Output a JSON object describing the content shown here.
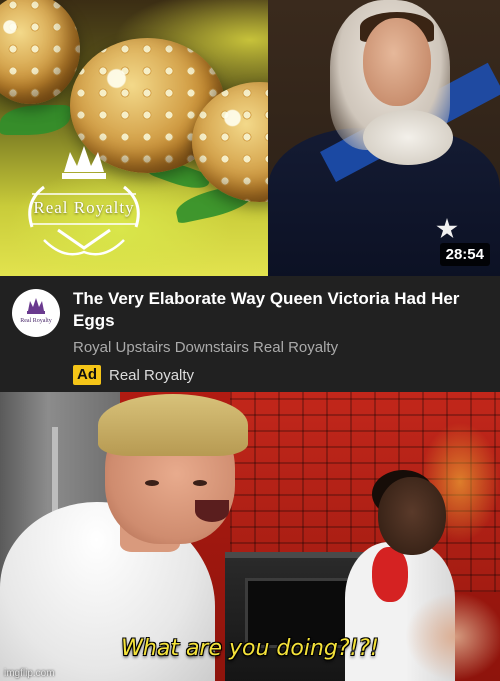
{
  "video": {
    "thumbnail_logo_text": "Real Royalty",
    "duration": "28:54",
    "title": "The Very Elaborate Way Queen Victoria Had Her Eggs",
    "channel_line": "Royal Upstairs Downstairs Real Royalty",
    "ad_badge": "Ad",
    "ad_channel": "Real Royalty",
    "avatar_text": "Real Royalty"
  },
  "meme": {
    "caption": "What are you doing?!?!",
    "watermark": "imgflip.com"
  },
  "colors": {
    "info_bar_bg": "#212121",
    "ad_badge": "#f5c518",
    "caption": "#f4e23a"
  }
}
